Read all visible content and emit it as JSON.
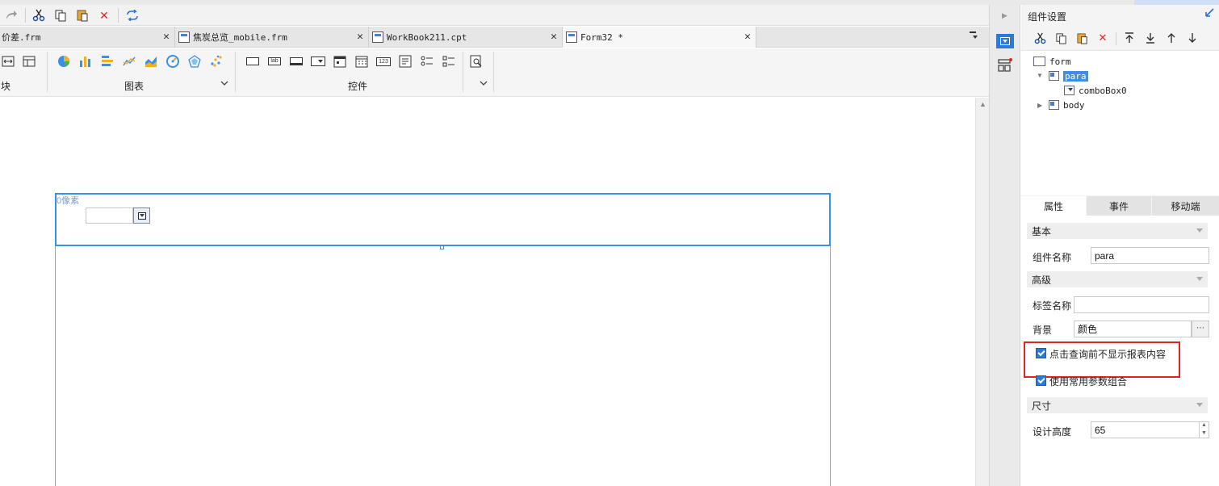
{
  "toolbar": {
    "icons": [
      "redo-icon",
      "cut-icon",
      "copy-icon",
      "paste-icon",
      "delete-icon",
      "refresh-icon"
    ]
  },
  "tabs": [
    {
      "label": "价差.frm",
      "icon": "form-file-icon",
      "active": false
    },
    {
      "label": "焦炭总览_mobile.frm",
      "icon": "form-file-icon",
      "active": false
    },
    {
      "label": "WorkBook211.cpt",
      "icon": "workbook-file-icon",
      "active": false
    },
    {
      "label": "Form32 *",
      "icon": "form-file-icon",
      "active": true
    }
  ],
  "ribbon": {
    "block_label": "块",
    "chart_label": "图表",
    "control_label": "控件",
    "controls_text": {
      "label": "lab",
      "number": "123"
    }
  },
  "canvas": {
    "para_hint": "0像素"
  },
  "panel": {
    "title": "组件设置",
    "tree": {
      "root": "form",
      "para": "para",
      "combo": "comboBox0",
      "body": "body"
    },
    "prop_tabs": [
      "属性",
      "事件",
      "移动端"
    ],
    "sections": {
      "basic": "基本",
      "advanced": "高级",
      "size": "尺寸"
    },
    "fields": {
      "widget_name_label": "组件名称",
      "widget_name_value": "para",
      "label_name_label": "标签名称",
      "label_name_value": "",
      "background_label": "背景",
      "background_value": "颜色",
      "design_height_label": "设计高度",
      "design_height_value": "65"
    },
    "checkboxes": {
      "hide_before_query": "点击查询前不显示报表内容",
      "use_common_params": "使用常用参数组合"
    }
  },
  "colors": {
    "accent_blue": "#3d8ee6",
    "highlight_red": "#e02424",
    "checkbox_blue": "#2d7ad6"
  }
}
